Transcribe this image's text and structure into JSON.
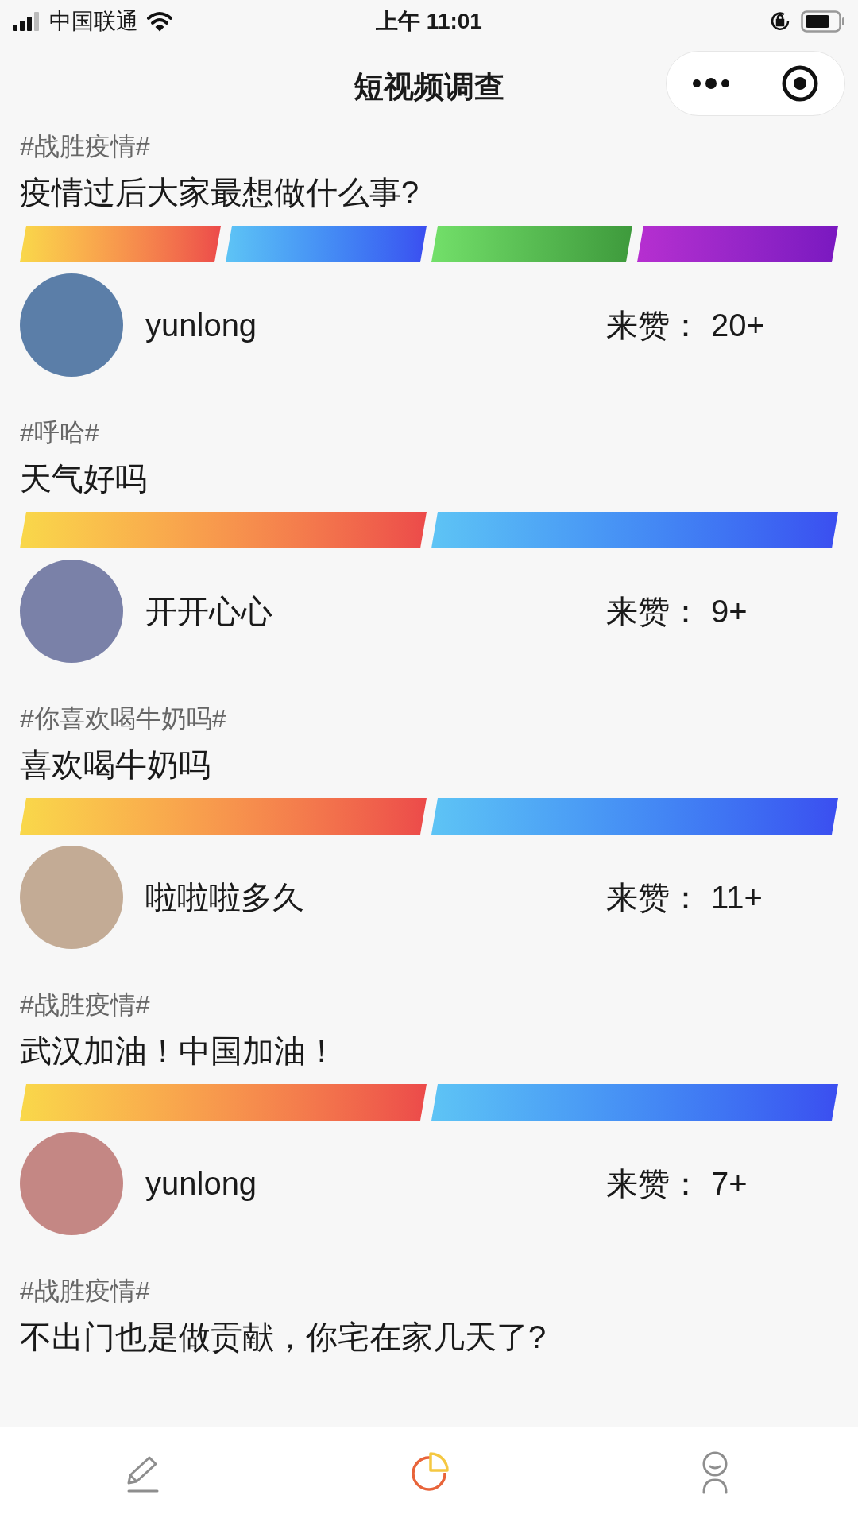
{
  "status_bar": {
    "carrier": "中国联通",
    "time": "上午 11:01"
  },
  "nav": {
    "title": "短视频调查"
  },
  "posts": [
    {
      "tag": "#战胜疫情#",
      "title": "疫情过后大家最想做什么事?",
      "bars": [
        {
          "kind": "orange"
        },
        {
          "kind": "blue"
        },
        {
          "kind": "green"
        },
        {
          "kind": "purple"
        }
      ],
      "user": "yunlong",
      "like_label": "来赞：",
      "likes": "20+"
    },
    {
      "tag": "#呼哈#",
      "title": "天气好吗",
      "bars": [
        {
          "kind": "orange"
        },
        {
          "kind": "blue"
        }
      ],
      "user": "开开心心",
      "like_label": "来赞：",
      "likes": "9+"
    },
    {
      "tag": "#你喜欢喝牛奶吗#",
      "title": "喜欢喝牛奶吗",
      "bars": [
        {
          "kind": "orange"
        },
        {
          "kind": "blue"
        }
      ],
      "user": "啦啦啦多久",
      "like_label": "来赞：",
      "likes": "11+"
    },
    {
      "tag": "#战胜疫情#",
      "title": "武汉加油！中国加油！",
      "bars": [
        {
          "kind": "orange"
        },
        {
          "kind": "blue"
        }
      ],
      "user": "yunlong",
      "like_label": "来赞：",
      "likes": "7+"
    },
    {
      "tag": "#战胜疫情#",
      "title": "不出门也是做贡献，你宅在家几天了?"
    }
  ],
  "tab_bar": [
    {
      "kind": "edit",
      "selected": false
    },
    {
      "kind": "chart",
      "selected": true
    },
    {
      "kind": "profile",
      "selected": false
    }
  ]
}
